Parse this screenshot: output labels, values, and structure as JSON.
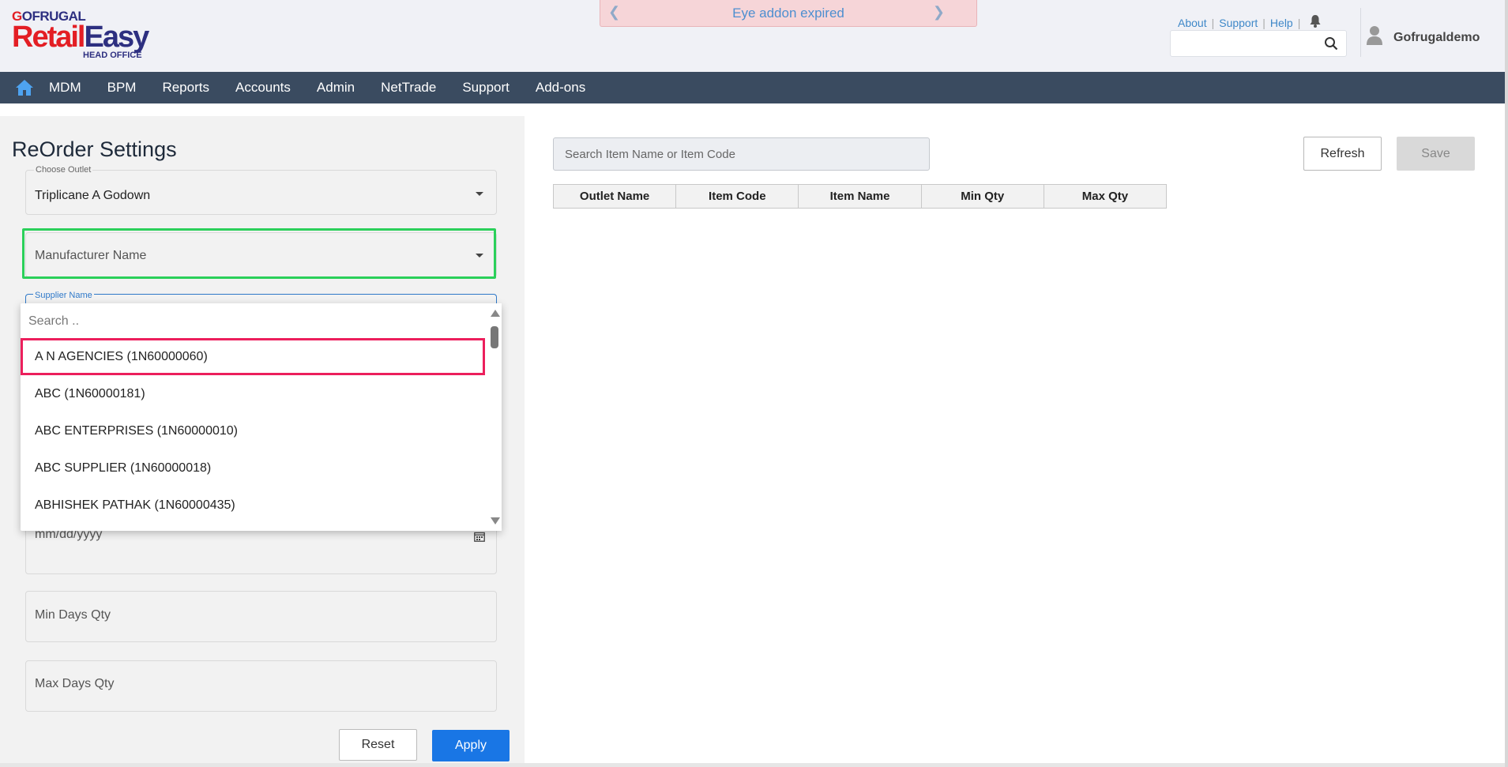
{
  "brand": {
    "top": "GOFRUGAL",
    "name_part1": "Retail",
    "name_part2": "Easy",
    "subtitle": "HEAD OFFICE",
    "color_red": "#e31e24",
    "color_blue": "#2d2f80"
  },
  "banner": {
    "text": "Eye addon expired",
    "prev_icon": "chevron-left-icon",
    "next_icon": "chevron-right-icon"
  },
  "top_links": {
    "about": "About",
    "support": "Support",
    "help": "Help"
  },
  "header_search": {
    "placeholder": "",
    "icon": "search-icon"
  },
  "user": {
    "name": "Gofrugaldemo",
    "icon": "user-icon"
  },
  "nav": {
    "home_icon": "home-icon",
    "items": [
      "MDM",
      "BPM",
      "Reports",
      "Accounts",
      "Admin",
      "NetTrade",
      "Support",
      "Add-ons"
    ],
    "bg_color": "#3a4b60"
  },
  "page": {
    "title": "ReOrder Settings"
  },
  "filters": {
    "outlet": {
      "label": "Choose Outlet",
      "value": "Triplicane A Godown"
    },
    "manufacturer": {
      "placeholder": "Manufacturer Name"
    },
    "supplier": {
      "label": "Supplier Name",
      "search_placeholder": "Search ..",
      "options": [
        "A N AGENCIES (1N60000060)",
        "ABC (1N60000181)",
        "ABC ENTERPRISES (1N60000010)",
        "ABC SUPPLIER (1N60000018)",
        "ABHISHEK PATHAK (1N60000435)"
      ]
    },
    "date": {
      "placeholder": "mm/dd/yyyy",
      "icon": "calendar-icon"
    },
    "min_days": {
      "placeholder": "Min Days Qty"
    },
    "max_days": {
      "placeholder": "Max Days Qty"
    },
    "reset_label": "Reset",
    "apply_label": "Apply"
  },
  "main": {
    "search_placeholder": "Search Item Name or Item Code",
    "refresh_label": "Refresh",
    "save_label": "Save",
    "columns": [
      "Outlet Name",
      "Item Code",
      "Item Name",
      "Min Qty",
      "Max Qty"
    ]
  }
}
